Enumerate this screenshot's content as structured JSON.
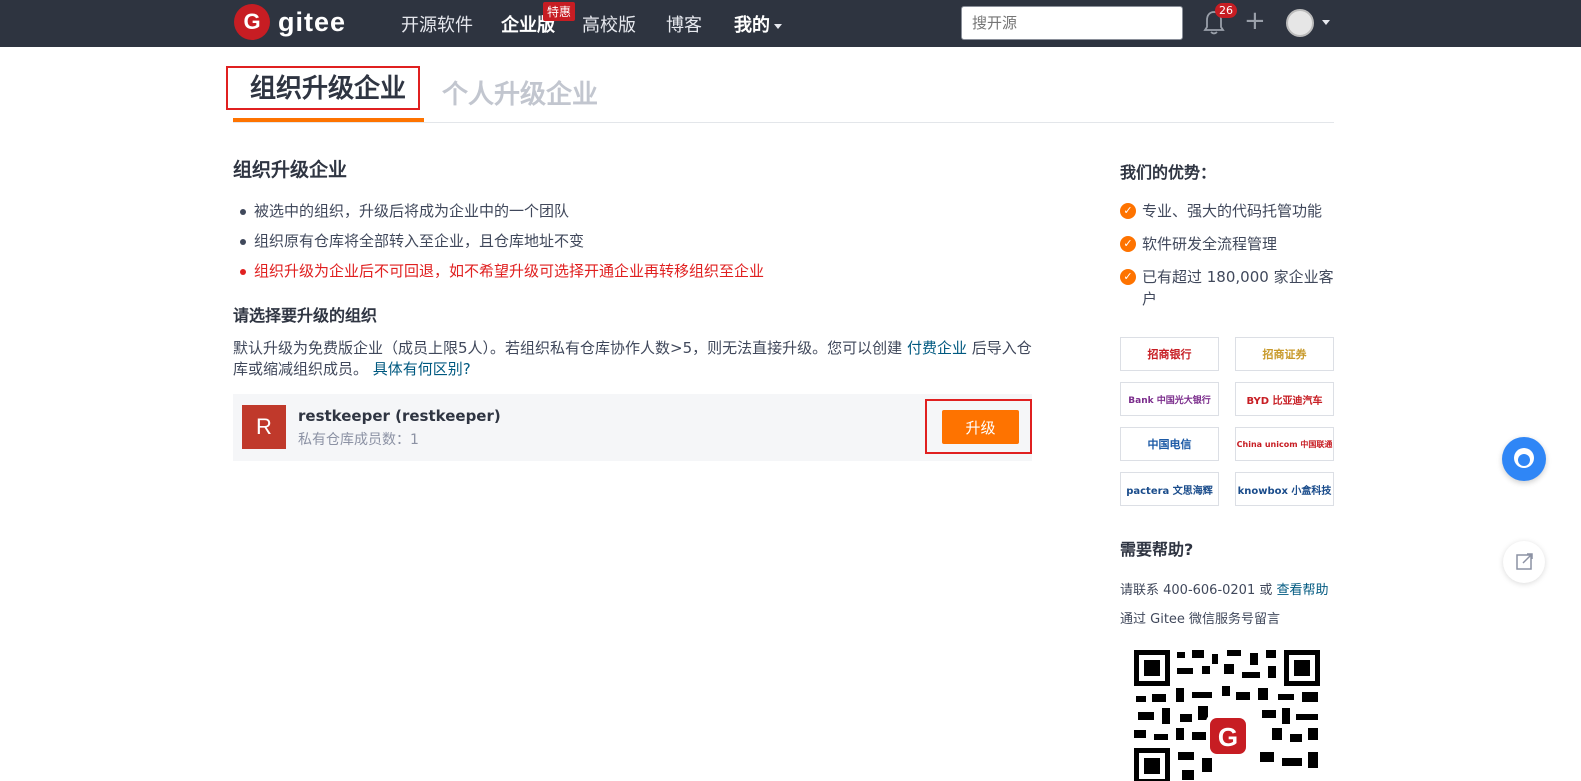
{
  "nav": {
    "logo_letter": "G",
    "logo_text": "gitee",
    "items": [
      "开源软件",
      "企业版",
      "高校版",
      "博客",
      "我的"
    ],
    "hot_badge": "特惠",
    "search_placeholder": "搜开源",
    "notification_count": "26"
  },
  "tabs": {
    "active": "组织升级企业",
    "inactive": "个人升级企业"
  },
  "main": {
    "title": "组织升级企业",
    "bullets": [
      "被选中的组织，升级后将成为企业中的一个团队",
      "组织原有仓库将全部转入至企业，且仓库地址不变",
      "组织升级为企业后不可回退，如不希望升级可选择开通企业再转移组织至企业"
    ],
    "select_title": "请选择要升级的组织",
    "desc_part1": "默认升级为免费版企业（成员上限5人）。若组织私有仓库协作人数>5，则无法直接升级。您可以创建 ",
    "desc_link1": "付费企业",
    "desc_part2": " 后导入仓库或缩减组织成员。 ",
    "desc_link2": "具体有何区别?",
    "org": {
      "avatar_letter": "R",
      "name": "restkeeper (restkeeper)",
      "member_count": "私有仓库成员数：1",
      "upgrade_label": "升级"
    }
  },
  "sidebar": {
    "advantages_title": "我们的优势：",
    "advantages": [
      "专业、强大的代码托管功能",
      "软件研发全流程管理",
      "已有超过 180,000 家企业客户"
    ],
    "logos": [
      "招商银行",
      "招商证券",
      "Bank 中国光大银行",
      "BYD 比亚迪汽车",
      "中国电信",
      "China unicom 中国联通",
      "pactera 文思海辉",
      "knowbox 小盒科技"
    ],
    "help_title": "需要帮助?",
    "help_contact": "请联系 400-606-0201 或 ",
    "help_link": "查看帮助",
    "help_wechat": "通过 Gitee 微信服务号留言"
  },
  "colors": {
    "brand": "#c71d23",
    "accent": "#fe7300",
    "link": "#005980",
    "nav_bg": "#2e3440"
  }
}
